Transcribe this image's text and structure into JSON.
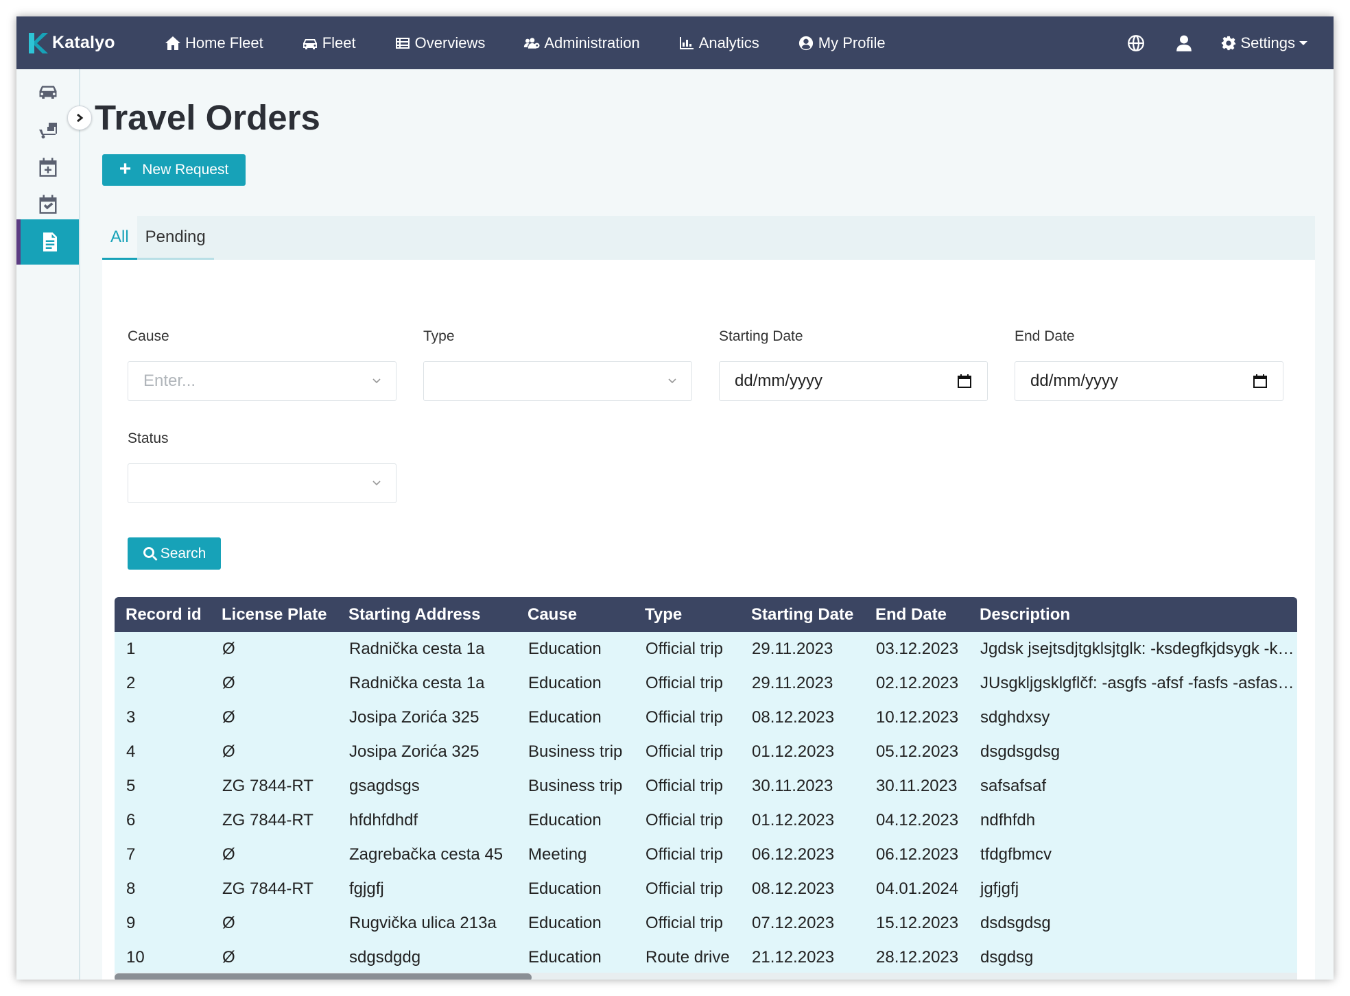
{
  "brand": {
    "name": "Katalyo"
  },
  "nav": {
    "items": [
      {
        "label": "Home Fleet",
        "icon": "home-icon"
      },
      {
        "label": "Fleet",
        "icon": "car-icon"
      },
      {
        "label": "Overviews",
        "icon": "list-icon"
      },
      {
        "label": "Administration",
        "icon": "users-icon"
      },
      {
        "label": "Analytics",
        "icon": "chart-icon"
      },
      {
        "label": "My Profile",
        "icon": "user-circle-icon"
      }
    ],
    "right": {
      "language_icon": "globe-icon",
      "user_icon": "user-icon",
      "settings_label": "Settings"
    }
  },
  "sidebar": {
    "items": [
      {
        "icon": "car-icon",
        "active": false
      },
      {
        "icon": "truck-loading-icon",
        "active": false
      },
      {
        "icon": "calendar-plus-icon",
        "active": false
      },
      {
        "icon": "calendar-check-icon",
        "active": false
      },
      {
        "icon": "document-icon",
        "active": true
      }
    ]
  },
  "page": {
    "title": "Travel Orders",
    "new_request_label": "New Request"
  },
  "tabs": [
    {
      "label": "All",
      "active": true
    },
    {
      "label": "Pending",
      "active": false
    }
  ],
  "filters": {
    "cause": {
      "label": "Cause",
      "placeholder": "Enter..."
    },
    "type": {
      "label": "Type",
      "value": ""
    },
    "starting_date": {
      "label": "Starting Date",
      "value": "dd/mm/yyyy"
    },
    "end_date": {
      "label": "End Date",
      "value": "dd/mm/yyyy"
    },
    "status": {
      "label": "Status",
      "value": ""
    },
    "search_label": "Search"
  },
  "table": {
    "columns": [
      "Record id",
      "License Plate",
      "Starting Address",
      "Cause",
      "Type",
      "Starting Date",
      "End Date",
      "Description"
    ],
    "rows": [
      [
        "1",
        "Ø",
        "Radnička cesta 1a",
        "Education",
        "Official trip",
        "29.11.2023",
        "03.12.2023",
        "Jgdsk jsejtsdjtgklsjtglk: -ksdegfkjdsygk -ksdegfkjdsygk"
      ],
      [
        "2",
        "Ø",
        "Radnička cesta 1a",
        "Education",
        "Official trip",
        "29.11.2023",
        "02.12.2023",
        "JUsgkljgsklgflčf: -asgfs -afsf -fasfs -asfas -asfasf"
      ],
      [
        "3",
        "Ø",
        "Josipa Zorića 325",
        "Education",
        "Official trip",
        "08.12.2023",
        "10.12.2023",
        "sdghdxsy"
      ],
      [
        "4",
        "Ø",
        "Josipa Zorića 325",
        "Business trip",
        "Official trip",
        "01.12.2023",
        "05.12.2023",
        "dsgdsgdsg"
      ],
      [
        "5",
        "ZG 7844-RT",
        "gsagdsgs",
        "Business trip",
        "Official trip",
        "30.11.2023",
        "30.11.2023",
        "safsafsaf"
      ],
      [
        "6",
        "ZG 7844-RT",
        "hfdhfdhdf",
        "Education",
        "Official trip",
        "01.12.2023",
        "04.12.2023",
        "ndfhfdh"
      ],
      [
        "7",
        "Ø",
        "Zagrebačka cesta 45",
        "Meeting",
        "Official trip",
        "06.12.2023",
        "06.12.2023",
        "tfdgfbmcv"
      ],
      [
        "8",
        "ZG 7844-RT",
        "fgjgfj",
        "Education",
        "Official trip",
        "08.12.2023",
        "04.01.2024",
        "jgfjgfj"
      ],
      [
        "9",
        "Ø",
        "Rugvička ulica 213a",
        "Education",
        "Official trip",
        "07.12.2023",
        "15.12.2023",
        "dsdsgdsg"
      ],
      [
        "10",
        "Ø",
        "sdgsdgdg",
        "Education",
        "Route drive",
        "21.12.2023",
        "28.12.2023",
        "dsgdsg"
      ]
    ]
  },
  "colors": {
    "navbar": "#3b4562",
    "accent": "#17a2b8",
    "row_bg": "#e1f6fa"
  }
}
